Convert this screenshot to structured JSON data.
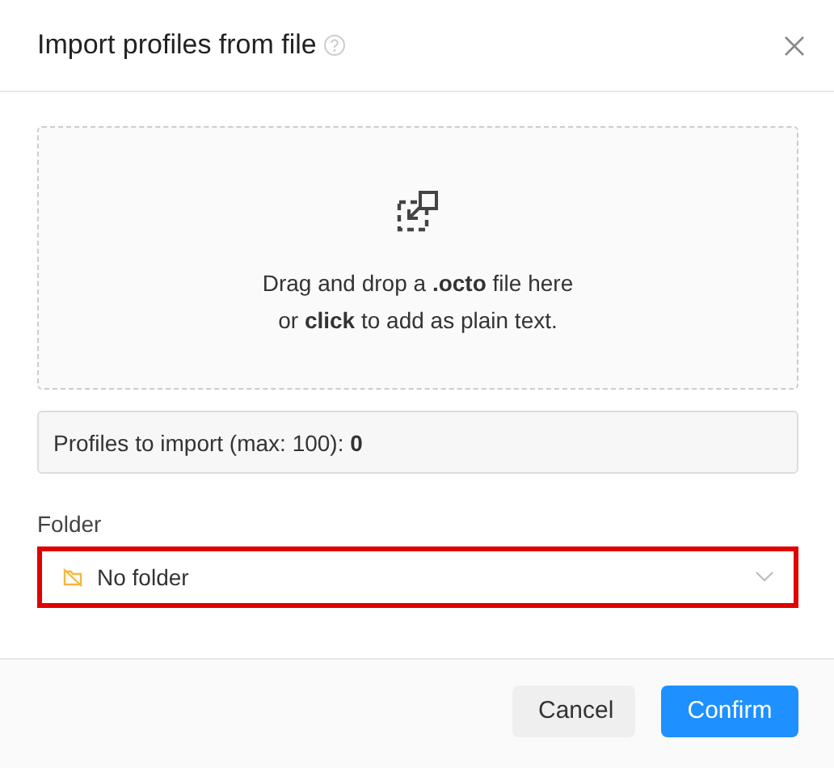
{
  "dialog": {
    "title": "Import profiles from file"
  },
  "dropzone": {
    "text": "Drag and drop a **.octo** file here\nor **click** to add as plain text."
  },
  "count": {
    "text": "Profiles to import (max: 100): **0**"
  },
  "folder": {
    "label": "Folder",
    "value": "No folder",
    "highlighted": true
  },
  "buttons": [
    {
      "label": "Cancel",
      "kind": "secondary"
    },
    {
      "label": "Confirm",
      "kind": "primary"
    }
  ]
}
